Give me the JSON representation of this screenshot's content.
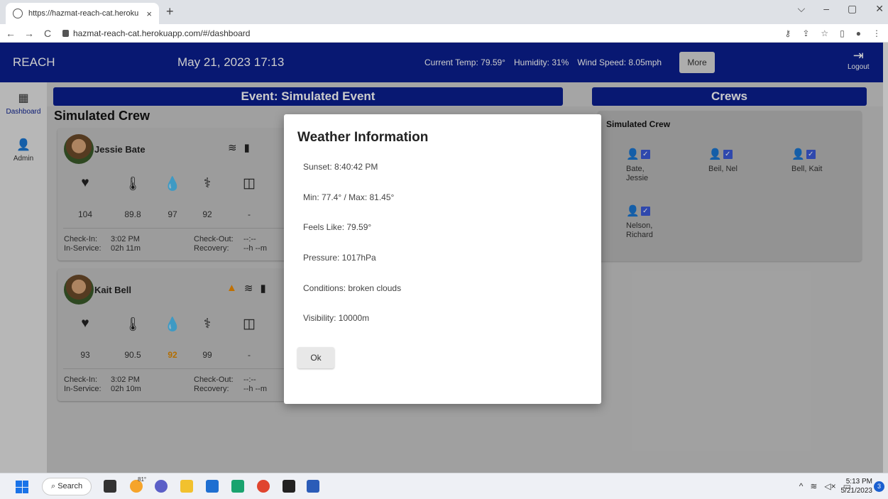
{
  "browser": {
    "tab_title": "https://hazmat-reach-cat.heroku",
    "url": "hazmat-reach-cat.herokuapp.com/#/dashboard"
  },
  "header": {
    "brand": "REACH",
    "datetime": "May 21, 2023  17:13",
    "current_temp": "Current Temp: 79.59°",
    "humidity": "Humidity: 31%",
    "wind_speed": "Wind Speed: 8.05mph",
    "more_label": "More",
    "logout_label": "Logout"
  },
  "sidebar": {
    "items": [
      {
        "label": "Dashboard",
        "icon": "dashboard-icon"
      },
      {
        "label": "Admin",
        "icon": "admin-icon"
      }
    ]
  },
  "event": {
    "title": "Event: Simulated Event",
    "crew_title": "Simulated Crew"
  },
  "cards": [
    {
      "name": "Jessie Bate",
      "vitals": [
        "104",
        "89.8",
        "97",
        "92",
        "-"
      ],
      "check_in_label": "Check-In:",
      "check_in": "3:02 PM",
      "check_out_label": "Check-Out:",
      "check_out": "--:--",
      "in_service_label": "In-Service:",
      "in_service": "02h 11m",
      "recovery_label": "Recovery:",
      "recovery": "--h --m"
    },
    {
      "name": "Kait Bell",
      "vitals": [
        "93",
        "90.5",
        "92",
        "99",
        "-"
      ],
      "check_in_label": "Check-In:",
      "check_in": "3:02 PM",
      "check_out_label": "Check-Out:",
      "check_out": "--:--",
      "in_service_label": "In-Service:",
      "in_service": "02h 10m",
      "recovery_label": "Recovery:",
      "recovery": "--h --m"
    }
  ],
  "crews": {
    "title": "Crews",
    "crew_name": "Simulated Crew",
    "members": [
      "Bate, Jessie",
      "Beil, Nel",
      "Bell, Kait",
      "Nelson,",
      "Richard"
    ]
  },
  "modal": {
    "title": "Weather Information",
    "sunset": "Sunset: 8:40:42 PM",
    "minmax": "Min: 77.4° / Max: 81.45°",
    "feels_like": "Feels Like: 79.59°",
    "pressure": "Pressure: 1017hPa",
    "conditions": "Conditions: broken clouds",
    "visibility": "Visibility: 10000m",
    "ok_label": "Ok"
  },
  "taskbar": {
    "search_label": "Search",
    "weather_temp": "81°",
    "time": "5:13 PM",
    "date": "5/21/2023",
    "notif_count": "3"
  },
  "colors": {
    "brand_blue": "#0a1f8f",
    "alert_orange": "#e08a00"
  }
}
